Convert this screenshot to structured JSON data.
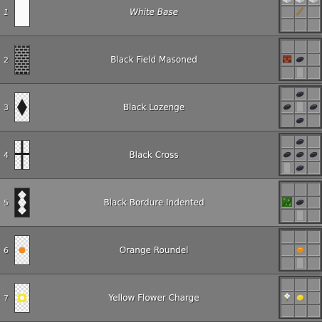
{
  "rows": [
    {
      "index": "1",
      "name": "White Base",
      "recipe": [
        "white-wool-block",
        "white-wool-block",
        "white-wool-block",
        "",
        "stick",
        "",
        "",
        " ",
        ""
      ]
    },
    {
      "index": "2",
      "name": "Black Field Masoned",
      "recipe": [
        "",
        "",
        "",
        "brick-item",
        "ink-sac-item",
        "",
        "",
        "banner-ghost",
        ""
      ]
    },
    {
      "index": "3",
      "name": "Black Lozenge",
      "recipe": [
        "",
        "ink-sac-item",
        "",
        "ink-sac-item",
        "banner-ghost",
        "ink-sac-item",
        "",
        "ink-sac-item",
        ""
      ]
    },
    {
      "index": "4",
      "name": "Black Cross",
      "recipe": [
        "",
        "ink-sac-item",
        "",
        "ink-sac-item",
        "ink-sac-item",
        "ink-sac-item",
        "banner-ghost",
        "ink-sac-item",
        ""
      ]
    },
    {
      "index": "5",
      "name": "Black Bordure Indented",
      "recipe": [
        "",
        "",
        "",
        "vines-item",
        "ink-sac-item",
        "",
        "",
        "banner-ghost",
        ""
      ]
    },
    {
      "index": "6",
      "name": "Orange Roundel",
      "recipe": [
        "",
        "",
        "",
        "",
        "orange-dye-item",
        "",
        "",
        "banner-ghost",
        ""
      ]
    },
    {
      "index": "7",
      "name": "Yellow Flower Charge",
      "recipe": [
        "",
        "",
        "",
        "oxeye-daisy-item",
        "yellow-dye-item",
        "",
        "",
        "",
        ""
      ]
    }
  ],
  "colors": {
    "black_pattern": "#1e1e1e",
    "orange": "#f58a1f",
    "yellow": "#f4e53a",
    "white_base": "#fbfbfb"
  },
  "icons": {
    "banner_patterns": [
      "white-base",
      "field-masoned",
      "lozenge",
      "cross",
      "bordure-indented",
      "roundel",
      "flower-charge"
    ]
  }
}
